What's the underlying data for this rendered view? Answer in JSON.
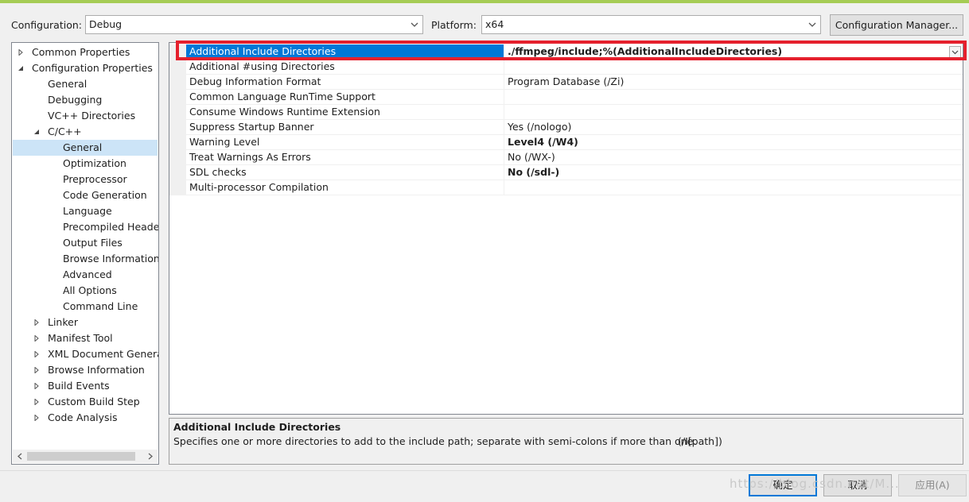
{
  "config": {
    "configuration_label": "Configuration:",
    "configuration_value": "Debug",
    "platform_label": "Platform:",
    "platform_value": "x64",
    "manager_button": "Configuration Manager..."
  },
  "tree": [
    {
      "label": "Common Properties",
      "level": 0,
      "toggle": "collapsed"
    },
    {
      "label": "Configuration Properties",
      "level": 0,
      "toggle": "expanded"
    },
    {
      "label": "General",
      "level": 1,
      "toggle": "none"
    },
    {
      "label": "Debugging",
      "level": 1,
      "toggle": "none"
    },
    {
      "label": "VC++ Directories",
      "level": 1,
      "toggle": "none"
    },
    {
      "label": "C/C++",
      "level": 1,
      "toggle": "expanded"
    },
    {
      "label": "General",
      "level": 2,
      "toggle": "none",
      "selected": true
    },
    {
      "label": "Optimization",
      "level": 2,
      "toggle": "none"
    },
    {
      "label": "Preprocessor",
      "level": 2,
      "toggle": "none"
    },
    {
      "label": "Code Generation",
      "level": 2,
      "toggle": "none"
    },
    {
      "label": "Language",
      "level": 2,
      "toggle": "none"
    },
    {
      "label": "Precompiled Header",
      "level": 2,
      "toggle": "none"
    },
    {
      "label": "Output Files",
      "level": 2,
      "toggle": "none"
    },
    {
      "label": "Browse Information",
      "level": 2,
      "toggle": "none"
    },
    {
      "label": "Advanced",
      "level": 2,
      "toggle": "none"
    },
    {
      "label": "All Options",
      "level": 2,
      "toggle": "none"
    },
    {
      "label": "Command Line",
      "level": 2,
      "toggle": "none"
    },
    {
      "label": "Linker",
      "level": 1,
      "toggle": "collapsed"
    },
    {
      "label": "Manifest Tool",
      "level": 1,
      "toggle": "collapsed"
    },
    {
      "label": "XML Document Generat",
      "level": 1,
      "toggle": "collapsed"
    },
    {
      "label": "Browse Information",
      "level": 1,
      "toggle": "collapsed"
    },
    {
      "label": "Build Events",
      "level": 1,
      "toggle": "collapsed"
    },
    {
      "label": "Custom Build Step",
      "level": 1,
      "toggle": "collapsed"
    },
    {
      "label": "Code Analysis",
      "level": 1,
      "toggle": "collapsed"
    }
  ],
  "properties": [
    {
      "name": "Additional Include Directories",
      "value": "./ffmpeg/include;%(AdditionalIncludeDirectories)",
      "bold": true,
      "selected": true
    },
    {
      "name": "Additional #using Directories",
      "value": "",
      "bold": false
    },
    {
      "name": "Debug Information Format",
      "value": "Program Database (/Zi)",
      "bold": false
    },
    {
      "name": "Common Language RunTime Support",
      "value": "",
      "bold": false
    },
    {
      "name": "Consume Windows Runtime Extension",
      "value": "",
      "bold": false
    },
    {
      "name": "Suppress Startup Banner",
      "value": "Yes (/nologo)",
      "bold": false
    },
    {
      "name": "Warning Level",
      "value": "Level4 (/W4)",
      "bold": true
    },
    {
      "name": "Treat Warnings As Errors",
      "value": "No (/WX-)",
      "bold": false
    },
    {
      "name": "SDL checks",
      "value": "No (/sdl-)",
      "bold": true
    },
    {
      "name": "Multi-processor Compilation",
      "value": "",
      "bold": false
    }
  ],
  "description": {
    "title": "Additional Include Directories",
    "text": "Specifies one or more directories to add to the include path; separate with semi-colons if more than one.",
    "flag": "(/I[path])"
  },
  "buttons": {
    "ok": "确定",
    "cancel": "取消",
    "apply": "应用(A)"
  },
  "watermark": "https://blog.csdn.net/M...",
  "colors": {
    "accent_top": "#a5cc55",
    "selection_blue": "#0078d7",
    "tree_selection": "#cce4f7",
    "highlight_red": "#e5202d"
  }
}
